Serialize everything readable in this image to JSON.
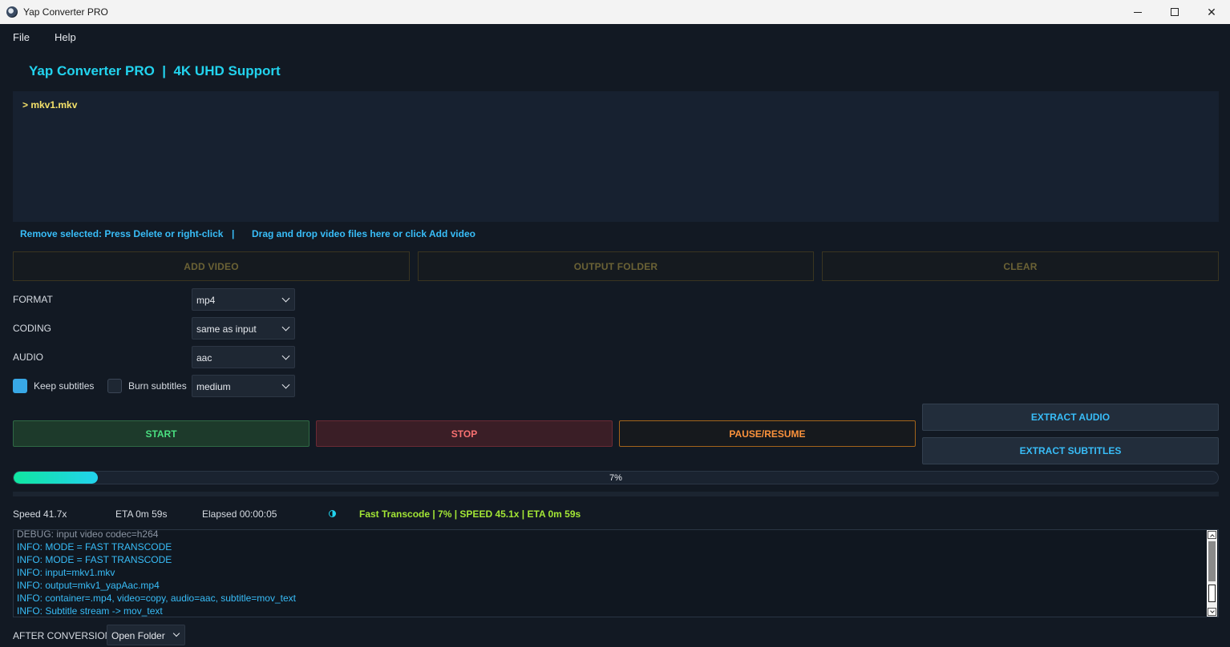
{
  "window": {
    "title": "Yap Converter PRO",
    "minimize_icon": "minimize-icon",
    "maximize_icon": "maximize-icon",
    "close_icon": "close-icon",
    "close_glyph": "✕"
  },
  "menu": {
    "items": [
      {
        "label": "File"
      },
      {
        "label": "Help"
      }
    ]
  },
  "heading": "Yap Converter PRO  |  4K UHD Support",
  "file_list": {
    "items": [
      {
        "label": "> mkv1.mkv"
      }
    ]
  },
  "hints": {
    "remove": "Remove selected: Press Delete or right-click",
    "separator": "|",
    "drag": "Drag and drop video files here or click Add video"
  },
  "buttons": {
    "add_video": "ADD VIDEO",
    "output_folder": "OUTPUT FOLDER",
    "clear": "CLEAR",
    "start": "START",
    "stop": "STOP",
    "pause_resume": "PAUSE/RESUME",
    "extract_audio": "EXTRACT AUDIO",
    "extract_subtitles": "EXTRACT SUBTITLES"
  },
  "options": {
    "format": {
      "label": "FORMAT",
      "value": "mp4"
    },
    "coding": {
      "label": "CODING",
      "value": "same as input"
    },
    "audio": {
      "label": "AUDIO",
      "value": "aac"
    },
    "keep_subtitles": {
      "label": "Keep subtitles",
      "checked": true
    },
    "burn_subtitles": {
      "label": "Burn subtitles",
      "checked": false
    },
    "quality": {
      "value": "medium"
    }
  },
  "progress": {
    "percent": 7,
    "label": "7%"
  },
  "stats": {
    "speed": "Speed 41.7x",
    "eta": "ETA 0m 59s",
    "elapsed": "Elapsed 00:00:05",
    "status": "Fast Transcode | 7% | SPEED 45.1x | ETA 0m 59s"
  },
  "log": {
    "lines": [
      {
        "level": "debug",
        "text": "DEBUG: input video codec=h264"
      },
      {
        "level": "info",
        "text": "INFO: MODE = FAST TRANSCODE"
      },
      {
        "level": "info",
        "text": "INFO: MODE = FAST TRANSCODE"
      },
      {
        "level": "info",
        "text": "INFO: input=mkv1.mkv"
      },
      {
        "level": "info",
        "text": "INFO: output=mkv1_yapAac.mp4"
      },
      {
        "level": "info",
        "text": "INFO: container=.mp4, video=copy, audio=aac, subtitle=mov_text"
      },
      {
        "level": "info",
        "text": "INFO: Subtitle stream -> mov_text"
      }
    ]
  },
  "after_conversion": {
    "label": "AFTER CONVERSION",
    "value": "Open Folder"
  },
  "colors": {
    "accent": "#22d3ee",
    "background": "#121923",
    "start": "#4ade80",
    "stop": "#f87171",
    "pause": "#fb923c",
    "status": "#a3e635"
  }
}
